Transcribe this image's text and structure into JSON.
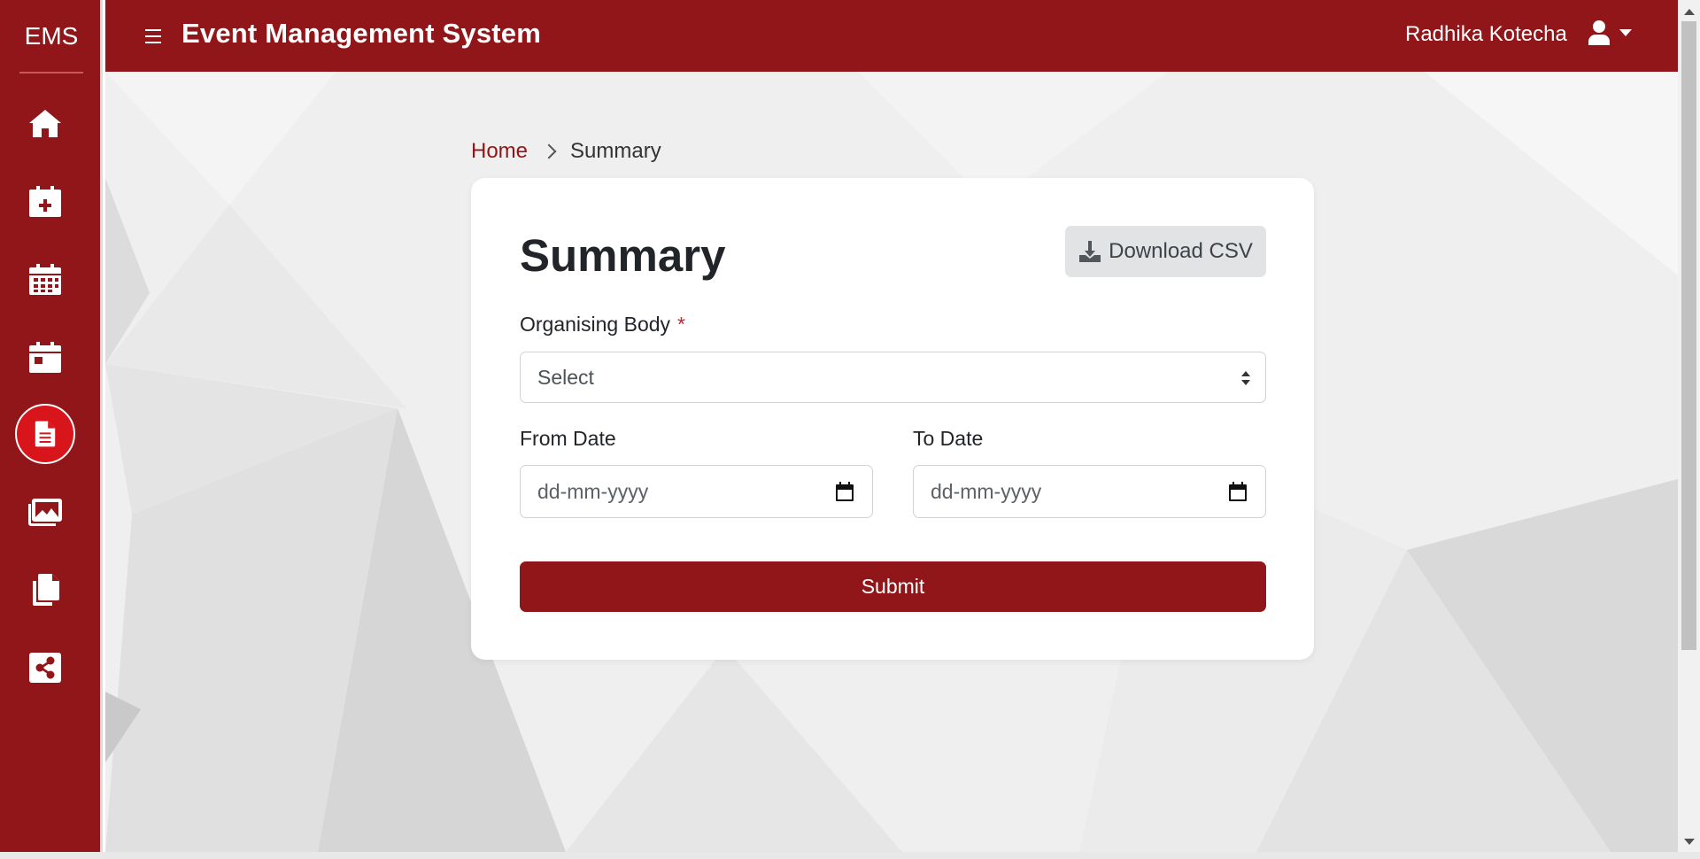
{
  "sidebar": {
    "brand": "EMS",
    "items": [
      {
        "icon": "home-icon",
        "active": false
      },
      {
        "icon": "calendar-plus-icon",
        "active": false
      },
      {
        "icon": "calendar-grid-icon",
        "active": false
      },
      {
        "icon": "calendar-day-icon",
        "active": false
      },
      {
        "icon": "document-icon",
        "active": true
      },
      {
        "icon": "images-icon",
        "active": false
      },
      {
        "icon": "copy-icon",
        "active": false
      },
      {
        "icon": "share-icon",
        "active": false
      }
    ]
  },
  "header": {
    "title": "Event Management System",
    "user_name": "Radhika Kotecha",
    "user_icon": "user-icon"
  },
  "breadcrumb": {
    "home": "Home",
    "current": "Summary"
  },
  "card": {
    "title": "Summary",
    "download_label": "Download CSV",
    "organising_body_label": "Organising Body",
    "required_mark": "*",
    "organising_body_value": "Select",
    "from_date_label": "From Date",
    "from_date_placeholder": "dd-mm-yyyy",
    "to_date_label": "To Date",
    "to_date_placeholder": "dd-mm-yyyy",
    "submit_label": "Submit"
  },
  "colors": {
    "brand": "#911619",
    "active_nav": "#d8151b",
    "required": "#c8232c"
  }
}
